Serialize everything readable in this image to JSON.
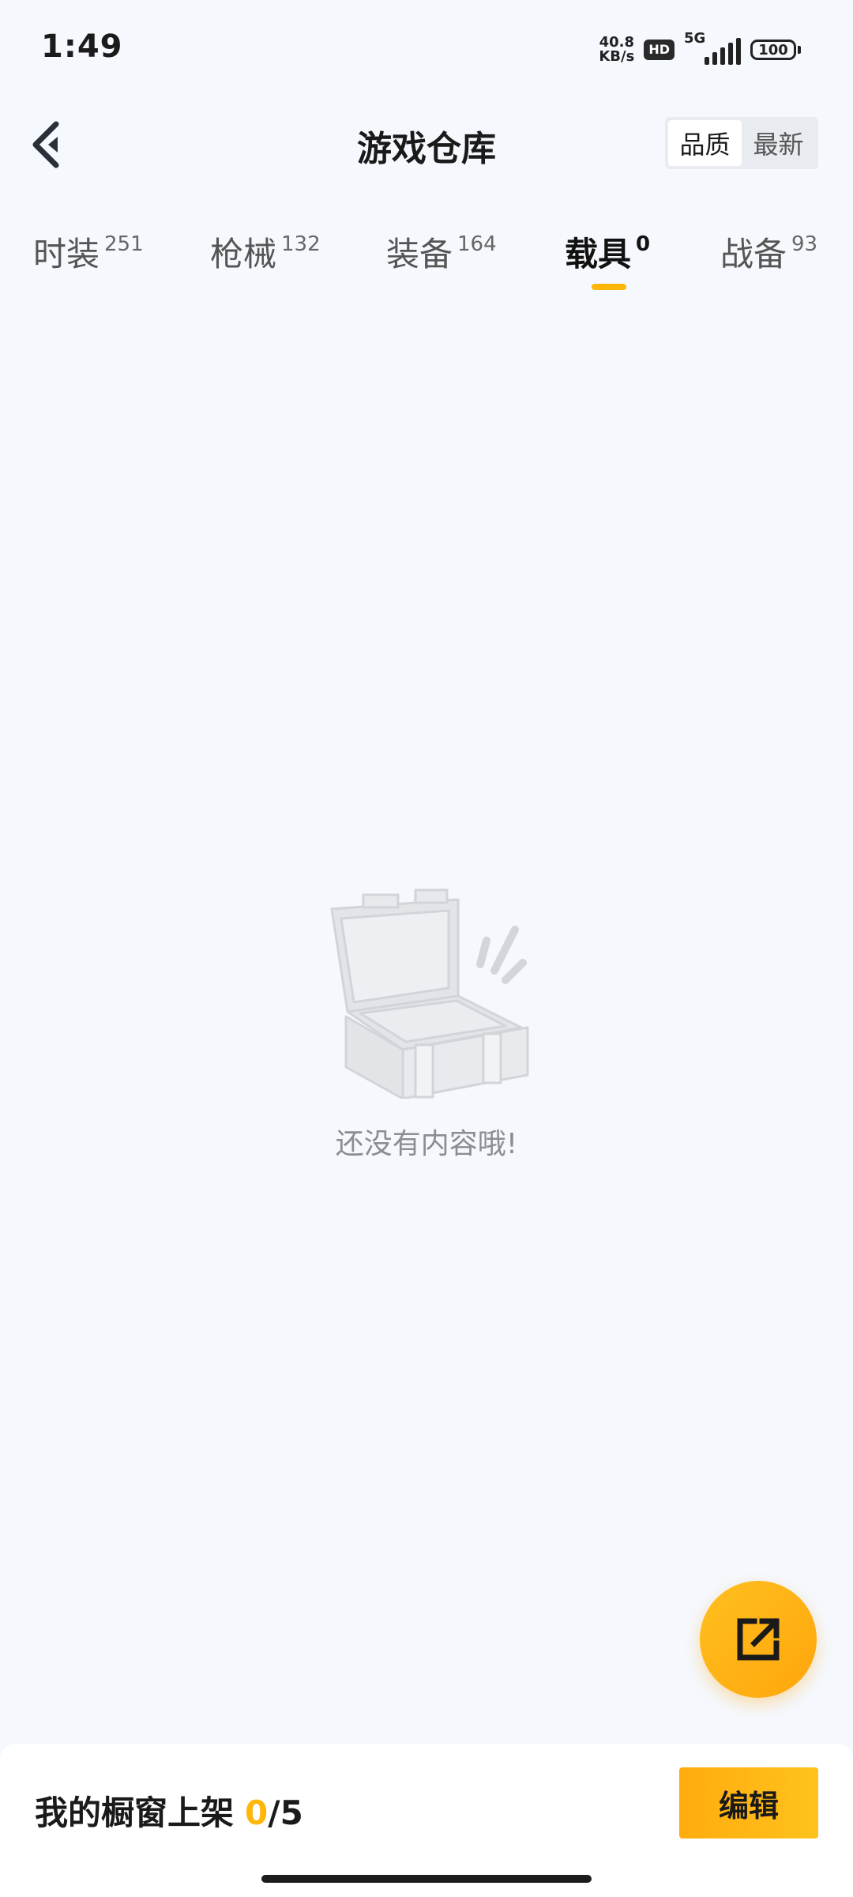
{
  "status_bar": {
    "time": "1:49",
    "net_speed_value": "40.8",
    "net_speed_unit": "KB/s",
    "hd_badge": "HD",
    "network_type": "5G",
    "battery": "100"
  },
  "header": {
    "title": "游戏仓库",
    "back_icon": "chevron-left-icon",
    "sort_options": [
      {
        "label": "品质",
        "active": true
      },
      {
        "label": "最新",
        "active": false
      }
    ]
  },
  "tabs": [
    {
      "label": "时装",
      "count": "251",
      "active": false
    },
    {
      "label": "枪械",
      "count": "132",
      "active": false
    },
    {
      "label": "装备",
      "count": "164",
      "active": false
    },
    {
      "label": "载具",
      "count": "0",
      "active": true
    },
    {
      "label": "战备",
      "count": "93",
      "active": false
    }
  ],
  "empty_state": {
    "icon": "open-chest-icon",
    "message": "还没有内容哦!"
  },
  "fab": {
    "icon": "share-external-icon"
  },
  "bottom_bar": {
    "label": "我的橱窗上架",
    "current": "0",
    "separator": "/",
    "total": "5",
    "edit_label": "编辑"
  },
  "colors": {
    "accent": "#ffb60a",
    "background": "#f5f8fd"
  }
}
